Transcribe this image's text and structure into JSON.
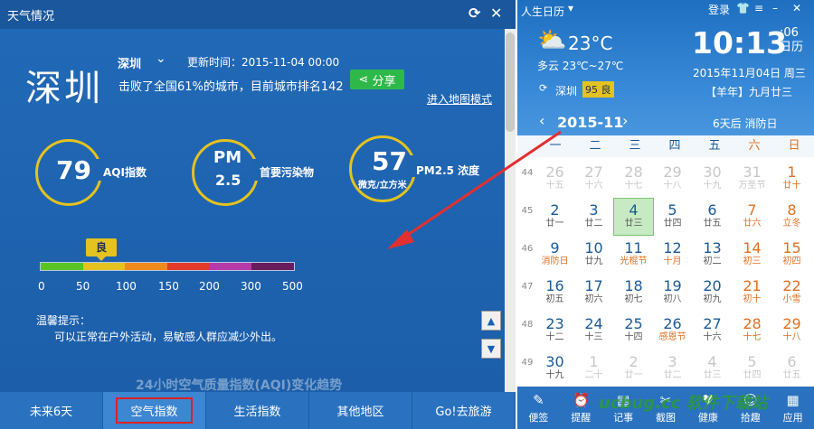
{
  "weather_window": {
    "title": "天气情况",
    "city": "深圳",
    "city_select": "深圳",
    "update_time": "更新时间：2015-11-04 00:00",
    "rank_text": "击败了全国61%的城市，目前城市排名142",
    "share_label": "分享",
    "map_link": "进入地图模式",
    "aqi": {
      "value": "79",
      "label": "AQI指数"
    },
    "pm": {
      "line1": "PM",
      "line2": "2.5",
      "label": "首要污染物"
    },
    "pm25": {
      "value": "57",
      "unit": "微克/立方米",
      "label": "PM2.5 浓度"
    },
    "level_badge": "良",
    "scale_ticks": [
      "0",
      "50",
      "100",
      "150",
      "200",
      "300",
      "500"
    ],
    "scale_colors": [
      "#59c424",
      "#e4c21f",
      "#ef8a1c",
      "#e23a2b",
      "#b63aa8",
      "#6a1d5e"
    ],
    "tips_title": "温馨提示：",
    "tips_text": "可以正常在户外活动，易敏感人群应减少外出。",
    "partial_heading": "24小时空气质量指数(AQI)变化趋势",
    "tabs": [
      "未来6天",
      "空气指数",
      "生活指数",
      "其他地区",
      "Go!去旅游"
    ],
    "active_tab": "空气指数"
  },
  "calendar": {
    "app_name": "人生日历",
    "login": "登录",
    "temp": "23°C",
    "condition": "多云 23℃~27℃",
    "city": "深圳",
    "aqi_badge": "95 良",
    "clock": "10:13",
    "seconds": ":06",
    "weekday_short": "日历",
    "date": "2015年11月04日 周三",
    "lunar": "【羊年】九月廿三",
    "month": "2015-11",
    "holiday_note": "6天后 消防日",
    "weekdays": [
      "一",
      "二",
      "三",
      "四",
      "五",
      "六",
      "日"
    ],
    "week_numbers": [
      "44",
      "45",
      "46",
      "47",
      "48",
      "49"
    ],
    "rows": [
      [
        {
          "d": "26",
          "l": "十五",
          "dim": true
        },
        {
          "d": "27",
          "l": "十六",
          "dim": true
        },
        {
          "d": "28",
          "l": "十七",
          "dim": true
        },
        {
          "d": "29",
          "l": "十八",
          "dim": true
        },
        {
          "d": "30",
          "l": "十九",
          "dim": true
        },
        {
          "d": "31",
          "l": "万圣节",
          "dim": true
        },
        {
          "d": "1",
          "l": "廿十"
        }
      ],
      [
        {
          "d": "2",
          "l": "廿一"
        },
        {
          "d": "3",
          "l": "廿二"
        },
        {
          "d": "4",
          "l": "廿三",
          "today": true
        },
        {
          "d": "5",
          "l": "廿四"
        },
        {
          "d": "6",
          "l": "廿五"
        },
        {
          "d": "7",
          "l": "廿六"
        },
        {
          "d": "8",
          "l": "立冬",
          "red": true
        }
      ],
      [
        {
          "d": "9",
          "l": "消防日",
          "red": true
        },
        {
          "d": "10",
          "l": "廿九"
        },
        {
          "d": "11",
          "l": "光棍节",
          "red": true
        },
        {
          "d": "12",
          "l": "十月",
          "red": true
        },
        {
          "d": "13",
          "l": "初二"
        },
        {
          "d": "14",
          "l": "初三"
        },
        {
          "d": "15",
          "l": "初四"
        }
      ],
      [
        {
          "d": "16",
          "l": "初五"
        },
        {
          "d": "17",
          "l": "初六"
        },
        {
          "d": "18",
          "l": "初七"
        },
        {
          "d": "19",
          "l": "初八"
        },
        {
          "d": "20",
          "l": "初九"
        },
        {
          "d": "21",
          "l": "初十"
        },
        {
          "d": "22",
          "l": "小雪",
          "red": true
        }
      ],
      [
        {
          "d": "23",
          "l": "十二"
        },
        {
          "d": "24",
          "l": "十三"
        },
        {
          "d": "25",
          "l": "十四"
        },
        {
          "d": "26",
          "l": "感恩节",
          "red": true
        },
        {
          "d": "27",
          "l": "十六"
        },
        {
          "d": "28",
          "l": "十七"
        },
        {
          "d": "29",
          "l": "十八"
        }
      ],
      [
        {
          "d": "30",
          "l": "十九"
        },
        {
          "d": "1",
          "l": "二十",
          "dim": true
        },
        {
          "d": "2",
          "l": "廿一",
          "dim": true
        },
        {
          "d": "3",
          "l": "廿二",
          "dim": true
        },
        {
          "d": "4",
          "l": "廿三",
          "dim": true
        },
        {
          "d": "5",
          "l": "廿四",
          "dim": true
        },
        {
          "d": "6",
          "l": "廿五",
          "dim": true
        }
      ]
    ],
    "tools": [
      {
        "label": "便签",
        "icon": "note-icon"
      },
      {
        "label": "提醒",
        "icon": "alarm-icon"
      },
      {
        "label": "记事",
        "icon": "memo-icon"
      },
      {
        "label": "截图",
        "icon": "screenshot-icon"
      },
      {
        "label": "健康",
        "icon": "health-icon"
      },
      {
        "label": "拾趣",
        "icon": "fun-icon"
      },
      {
        "label": "应用",
        "icon": "apps-icon"
      }
    ]
  },
  "watermark": "ucbug.cc 软件下载站"
}
